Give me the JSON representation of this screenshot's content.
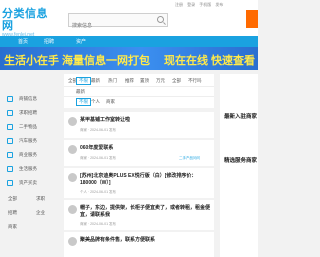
{
  "header": {
    "logo_text": "分类信息网",
    "logo_sub": "www.fenlei.net",
    "search_placeholder": "搜索信息",
    "top_links": [
      "注册",
      "登录",
      "手机版",
      "发布"
    ],
    "accent_color": "#1aa2e0",
    "post_button_color": "#ff6a00"
  },
  "nav": {
    "items": [
      "首页",
      "招聘",
      "资产"
    ]
  },
  "banner": {
    "left_text": "生活小在手 海量信息一网打包",
    "right_text": "现在在线 快速查看"
  },
  "sidebar": {
    "items": [
      {
        "label": "商铺信息",
        "icon": "shop-icon"
      },
      {
        "label": "求职招聘",
        "icon": "briefcase-icon"
      },
      {
        "label": "二手物品",
        "icon": "box-icon"
      },
      {
        "label": "汽车服务",
        "icon": "car-icon"
      },
      {
        "label": "商业服务",
        "icon": "service-icon"
      },
      {
        "label": "生活服务",
        "icon": "life-icon"
      },
      {
        "label": "资产买卖",
        "icon": "asset-icon"
      }
    ],
    "bottom_items": [
      "全部",
      "求职",
      "招聘",
      "企业",
      "商家"
    ]
  },
  "filter": {
    "row1": [
      "全部",
      "不限",
      "最新",
      "热门",
      "推荐",
      "置顶",
      "附近",
      "区域",
      "更多",
      "万元",
      "全部",
      "不行吗"
    ],
    "row2": [
      "最新"
    ],
    "row3": [
      "不限",
      "个人",
      "商家"
    ]
  },
  "feed": {
    "posts": [
      {
        "title": "某甲基铺工作室转让啦",
        "meta": "商家 · 2024-06-01 发布",
        "category": ""
      },
      {
        "title": "060年度爱联系",
        "meta": "商家 · 2024-06-01 发布",
        "category": "二手产品问问"
      },
      {
        "title": "[苏州]北京迪奥PLUS EX悦行版（白）[修改排序价：180000（W）]",
        "meta": "个人 · 2024-06-01 发布",
        "category": ""
      },
      {
        "title": "帽子，东边，提供架，长柜子便宜卖了，或者转租，租金便宜，请联系我",
        "meta": "商家 · 2024-06-01 发布",
        "category": ""
      },
      {
        "title": "聚美品牌有条件售，联系方便联系",
        "meta": "",
        "category": ""
      }
    ]
  },
  "right_panel": {
    "title1": "最新入驻商家",
    "title2": "精选服务商家"
  }
}
